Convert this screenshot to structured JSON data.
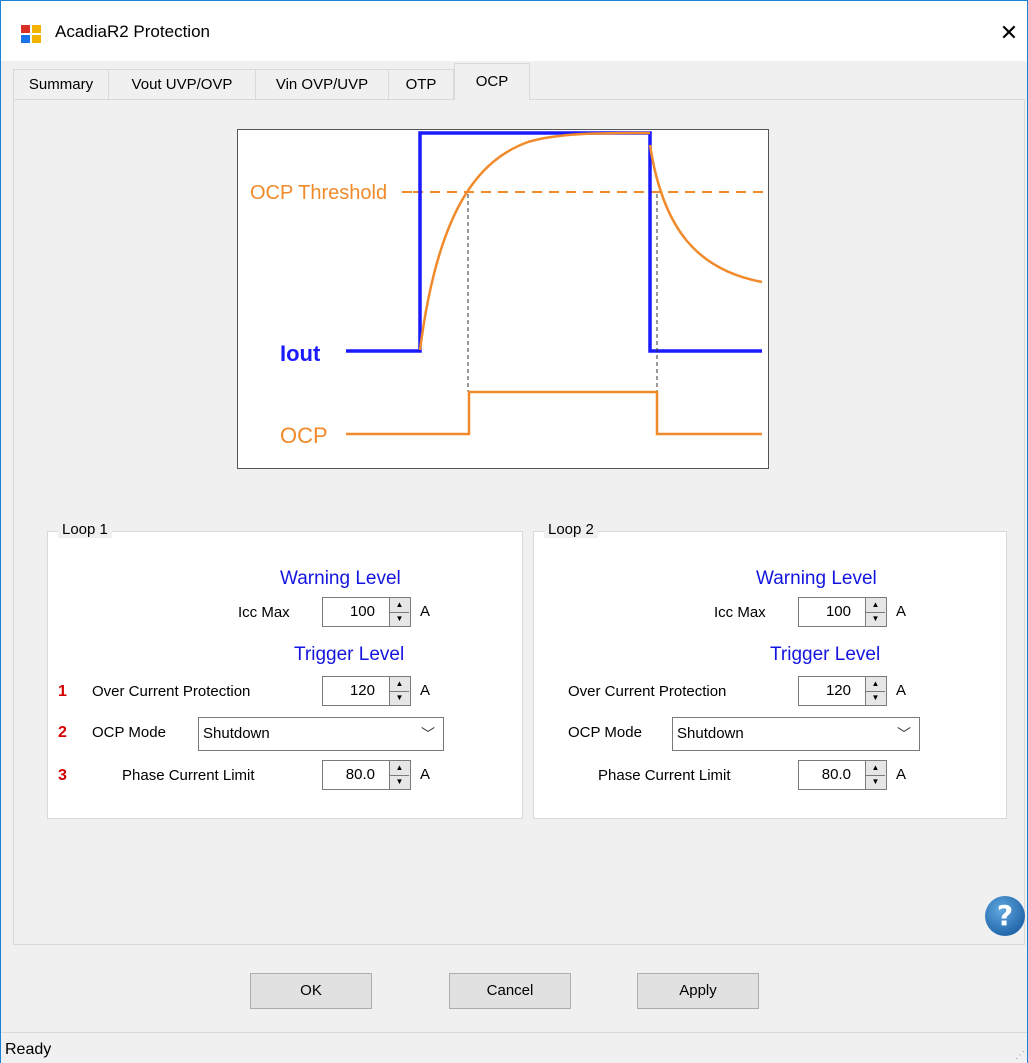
{
  "window": {
    "title": "AcadiaR2 Protection",
    "close_glyph": "✕"
  },
  "tabs": [
    {
      "label": "Summary"
    },
    {
      "label": "Vout UVP/OVP"
    },
    {
      "label": "Vin OVP/UVP"
    },
    {
      "label": "OTP"
    },
    {
      "label": "OCP"
    }
  ],
  "active_tab": "OCP",
  "diagram": {
    "threshold_label": "OCP Threshold",
    "iout_label": "Iout",
    "ocp_label": "OCP",
    "colors": {
      "iout": "#1a1aff",
      "current": "#f08a2a",
      "ocp": "#f08a2a"
    }
  },
  "loops": [
    {
      "legend": "Loop 1",
      "warning_heading": "Warning Level",
      "icc_max_label": "Icc Max",
      "icc_max_value": "100",
      "trigger_heading": "Trigger Level",
      "ocp_label": "Over Current Protection",
      "ocp_value": "120",
      "mode_label": "OCP Mode",
      "mode_value": "Shutdown",
      "phase_label": "Phase Current Limit",
      "phase_value": "80.0",
      "unit": "A",
      "steps": [
        "1",
        "2",
        "3"
      ]
    },
    {
      "legend": "Loop 2",
      "warning_heading": "Warning Level",
      "icc_max_label": "Icc Max",
      "icc_max_value": "100",
      "trigger_heading": "Trigger Level",
      "ocp_label": "Over Current Protection",
      "ocp_value": "120",
      "mode_label": "OCP Mode",
      "mode_value": "Shutdown",
      "phase_label": "Phase Current Limit",
      "phase_value": "80.0",
      "unit": "A"
    }
  ],
  "buttons": {
    "ok": "OK",
    "cancel": "Cancel",
    "apply": "Apply"
  },
  "help_glyph": "?",
  "status": "Ready"
}
